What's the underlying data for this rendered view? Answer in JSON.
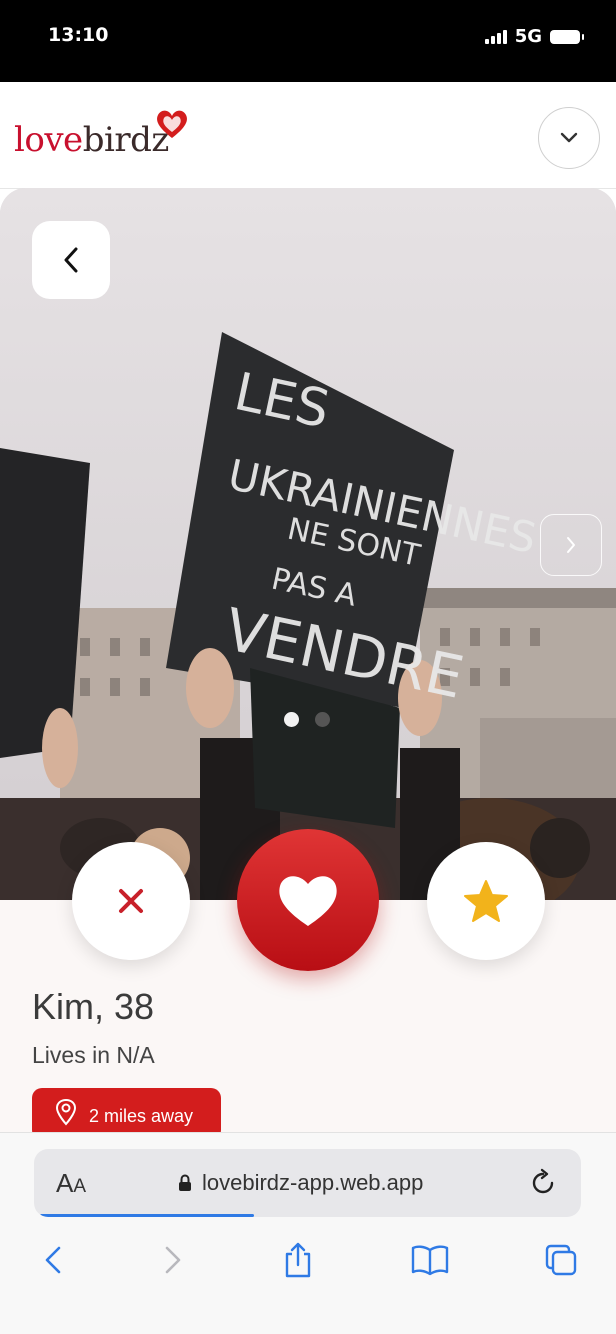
{
  "status_bar": {
    "time": "13:10",
    "network": "5G"
  },
  "header": {
    "logo_love": "love",
    "logo_birdz": "birdz"
  },
  "profile": {
    "name_age": "Kim, 38",
    "location": "Lives in N/A",
    "distance": "2 miles away",
    "photo_sign_text": "LES UKRAINIENNES NE SONT PAS A VENDRE"
  },
  "carousel": {
    "photo_count": 2,
    "active_index": 0
  },
  "browser": {
    "aa_big": "A",
    "aa_small": "A",
    "url": "lovebirdz-app.web.app"
  },
  "colors": {
    "brand_red": "#d31d1d",
    "star_gold": "#f2b31b",
    "ios_blue": "#2f7ae5"
  },
  "icons": [
    "chevron-down-icon",
    "back-chevron-icon",
    "next-chevron-icon",
    "close-icon",
    "heart-icon",
    "star-icon",
    "location-pin-icon",
    "lock-icon",
    "reload-icon",
    "share-icon",
    "bookmarks-icon",
    "tabs-icon"
  ]
}
